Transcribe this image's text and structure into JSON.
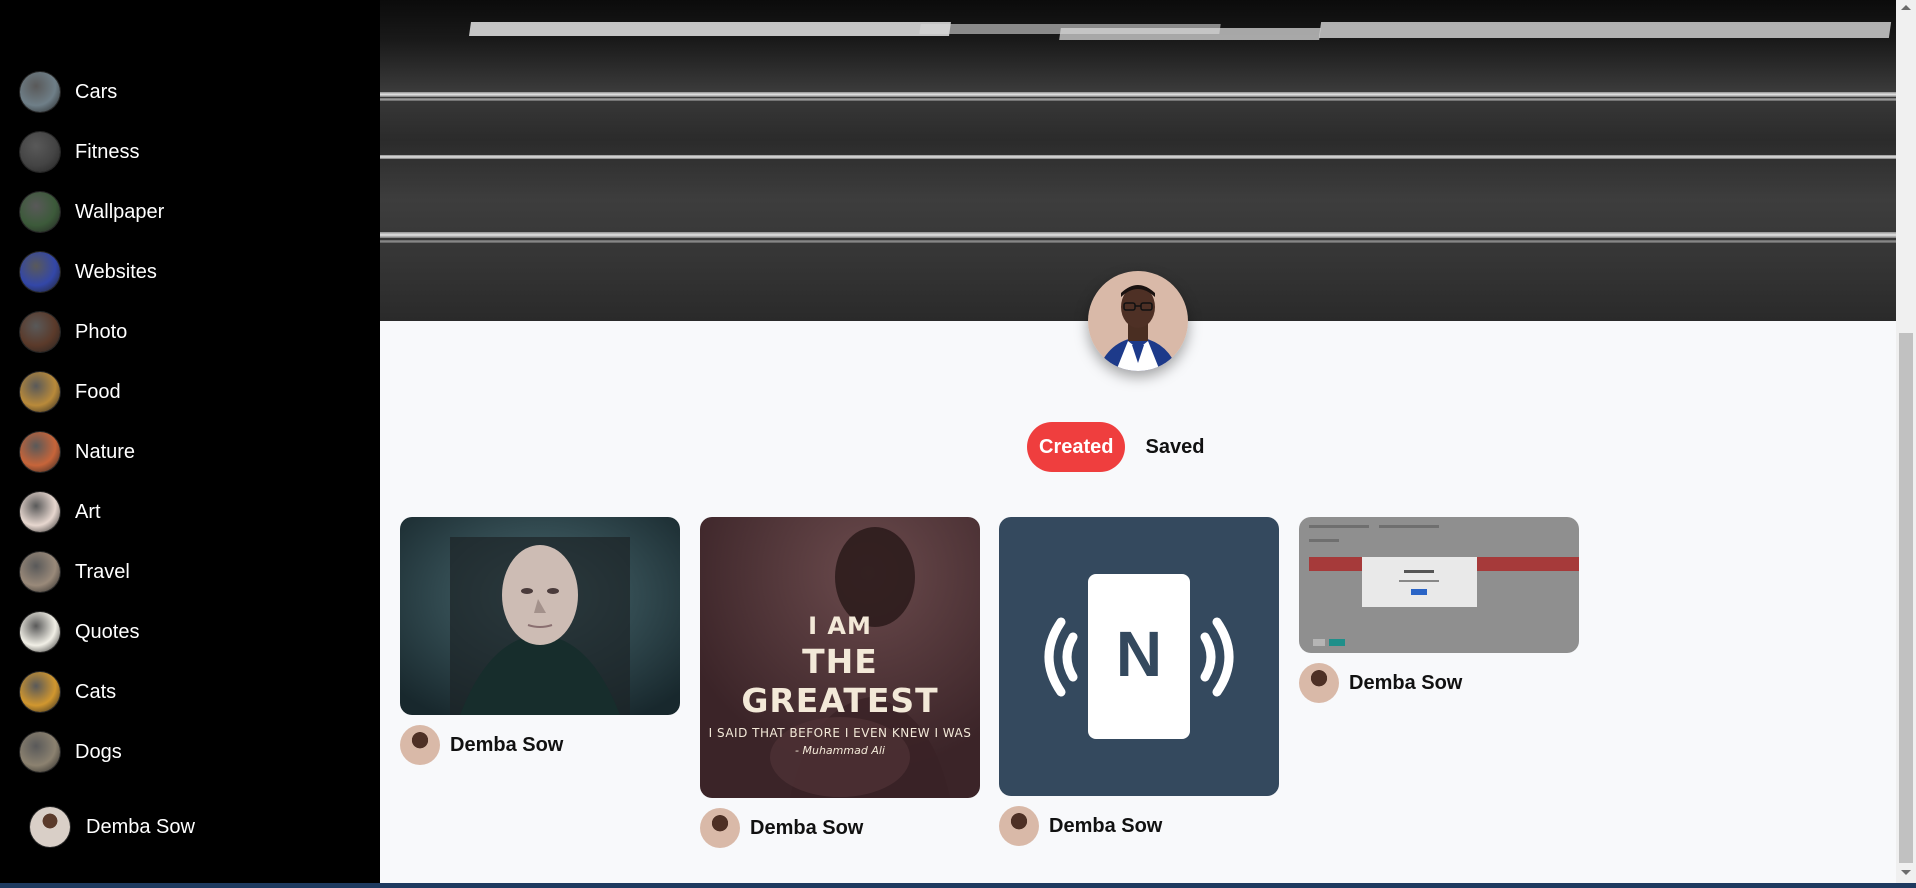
{
  "sidebar": {
    "categories": [
      {
        "label": "Cars",
        "thumb_color": "#6f7f88"
      },
      {
        "label": "Fitness",
        "thumb_color": "#444444"
      },
      {
        "label": "Wallpaper",
        "thumb_color": "#3c5a3a"
      },
      {
        "label": "Websites",
        "thumb_color": "#3347a8"
      },
      {
        "label": "Photo",
        "thumb_color": "#5b3a2a"
      },
      {
        "label": "Food",
        "thumb_color": "#b98a3a"
      },
      {
        "label": "Nature",
        "thumb_color": "#c7653a"
      },
      {
        "label": "Art",
        "thumb_color": "#e7d7cf"
      },
      {
        "label": "Travel",
        "thumb_color": "#9a8a7a"
      },
      {
        "label": "Quotes",
        "thumb_color": "#f1efe6"
      },
      {
        "label": "Cats",
        "thumb_color": "#d1972f"
      },
      {
        "label": "Dogs",
        "thumb_color": "#8c8270"
      }
    ],
    "user": {
      "name": "Demba Sow"
    }
  },
  "profile": {
    "tabs": {
      "created": "Created",
      "saved": "Saved"
    },
    "accent_color": "#ef3e3e"
  },
  "pins": [
    {
      "author": "Demba Sow",
      "image": "villain-portrait"
    },
    {
      "author": "Demba Sow",
      "image": "quote-poster",
      "quote_line1": "I AM",
      "quote_line2": "THE GREATEST",
      "quote_line3": "I SAID THAT BEFORE I EVEN KNEW I WAS",
      "quote_sig": "- Muhammad Ali"
    },
    {
      "author": "Demba Sow",
      "image": "nfc-logo",
      "logo_letter": "N"
    },
    {
      "author": "Demba Sow",
      "image": "dialog-screenshot"
    }
  ]
}
